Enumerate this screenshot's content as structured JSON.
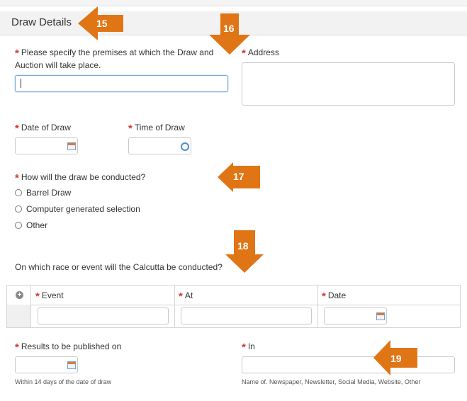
{
  "section": {
    "title": "Draw Details"
  },
  "fields": {
    "premises": {
      "label": "Please specify the premises at which the Draw and Auction will take place.",
      "value": ""
    },
    "address": {
      "label": "Address",
      "value": ""
    },
    "date_of_draw": {
      "label": "Date of Draw",
      "value": ""
    },
    "time_of_draw": {
      "label": "Time of Draw",
      "value": ""
    },
    "draw_method": {
      "label": "How will the draw be conducted?",
      "options": [
        "Barrel Draw",
        "Computer generated selection",
        "Other"
      ],
      "selected": null
    },
    "race_event": {
      "label": "On which race or event will the Calcutta be conducted?"
    },
    "results_published_on": {
      "label": "Results to be published on",
      "hint": "Within 14 days of the date of draw",
      "value": ""
    },
    "in": {
      "label": "In",
      "hint": "Name of. Newspaper, Newsletter, Social Media, Website, Other",
      "value": ""
    }
  },
  "event_table": {
    "columns": [
      "Event",
      "At",
      "Date"
    ]
  },
  "callouts": [
    "15",
    "16",
    "17",
    "18",
    "19"
  ],
  "colors": {
    "required": "#d33a2c",
    "callout": "#e07516",
    "focus": "#7aa7d6"
  }
}
